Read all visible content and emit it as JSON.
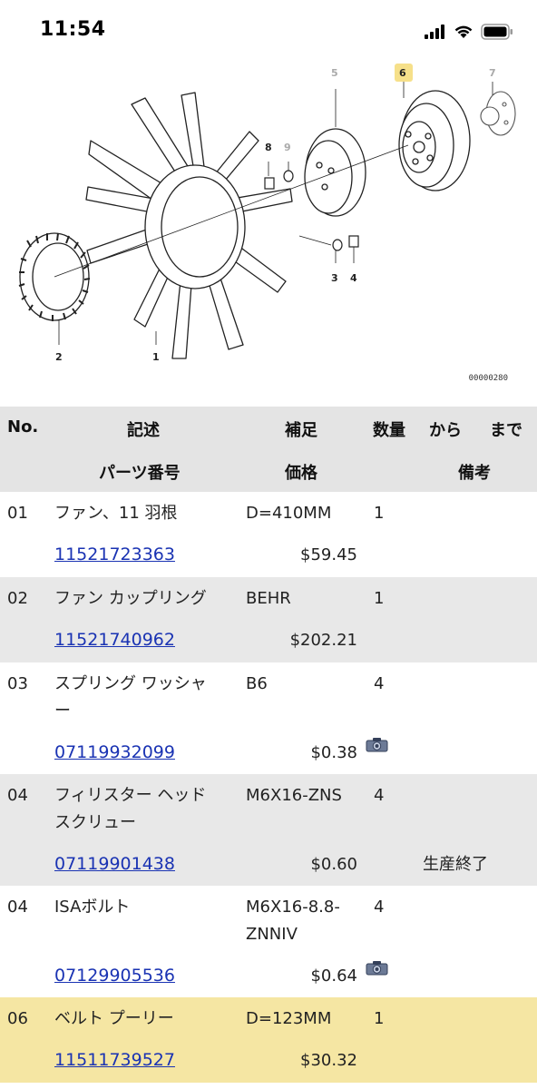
{
  "status": {
    "time": "11:54"
  },
  "diagram": {
    "callouts": [
      "1",
      "2",
      "3",
      "4",
      "5",
      "6",
      "7",
      "8",
      "9"
    ],
    "selected_callout": "6",
    "code": "00000280"
  },
  "table": {
    "headers": {
      "no": "No.",
      "desc": "記述",
      "supp": "補足",
      "qty": "数量",
      "from": "から",
      "to": "まで",
      "partno": "パーツ番号",
      "price": "価格",
      "notes": "備考"
    },
    "rows": [
      {
        "no": "01",
        "desc": "ファン、11 羽根",
        "desc2": "",
        "supp": "D=410MM",
        "supp2": "",
        "qty": "1",
        "partno": "11521723363",
        "price": "$59.45",
        "note": ""
      },
      {
        "no": "02",
        "desc": "ファン カップリング",
        "desc2": "",
        "supp": "BEHR",
        "supp2": "",
        "qty": "1",
        "partno": "11521740962",
        "price": "$202.21",
        "note": ""
      },
      {
        "no": "03",
        "desc": "スプリング ワッシャ",
        "desc2": "ー",
        "supp": "B6",
        "supp2": "",
        "qty": "4",
        "partno": "07119932099",
        "price": "$0.38",
        "note": ""
      },
      {
        "no": "04",
        "desc": "フィリスター ヘッド",
        "desc2": "スクリュー",
        "supp": "M6X16-ZNS",
        "supp2": "",
        "qty": "4",
        "partno": "07119901438",
        "price": "$0.60",
        "note": "生産終了"
      },
      {
        "no": "04",
        "desc": "ISAボルト",
        "desc2": "",
        "supp": "M6X16-8.8-",
        "supp2": "ZNNIV",
        "qty": "4",
        "partno": "07129905536",
        "price": "$0.64",
        "note": ""
      },
      {
        "no": "06",
        "desc": "ベルト プーリー",
        "desc2": "",
        "supp": "D=123MM",
        "supp2": "",
        "qty": "1",
        "partno": "11511739527",
        "price": "$30.32",
        "note": ""
      }
    ]
  }
}
